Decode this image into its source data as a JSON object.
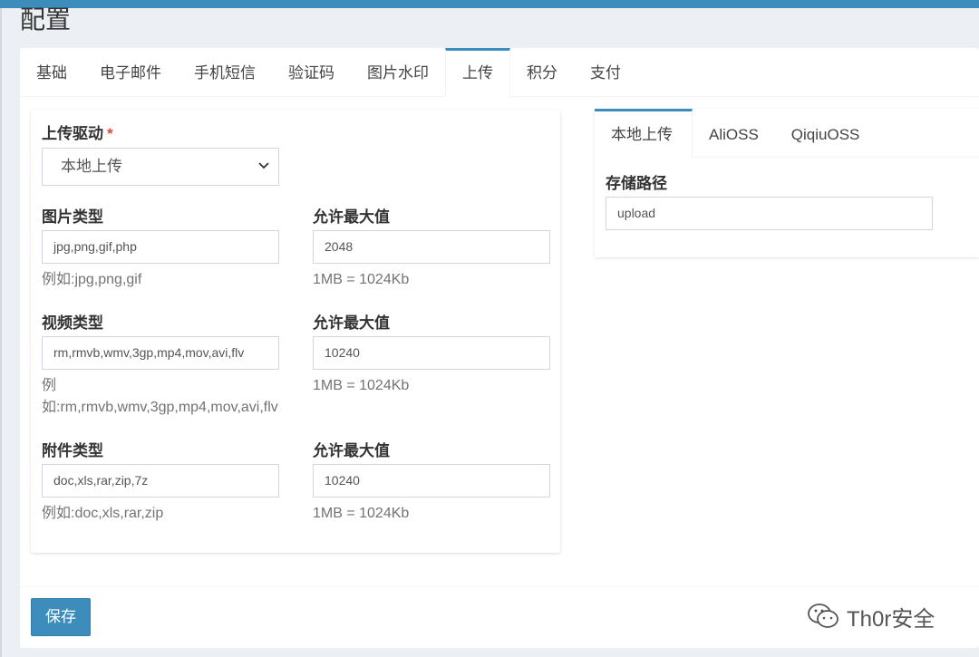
{
  "page": {
    "title": "配置"
  },
  "tabs": [
    {
      "label": "基础"
    },
    {
      "label": "电子邮件"
    },
    {
      "label": "手机短信"
    },
    {
      "label": "验证码"
    },
    {
      "label": "图片水印"
    },
    {
      "label": "上传"
    },
    {
      "label": "积分"
    },
    {
      "label": "支付"
    }
  ],
  "active_tab": "上传",
  "upload": {
    "driver_label": "上传驱动",
    "required_mark": "*",
    "driver_value": "本地上传",
    "image_type_label": "图片类型",
    "image_type_value": "jpg,png,gif,php",
    "image_type_help": "例如:jpg,png,gif",
    "image_max_label": "允许最大值",
    "image_max_value": "2048",
    "image_max_help": "1MB = 1024Kb",
    "video_type_label": "视频类型",
    "video_type_value": "rm,rmvb,wmv,3gp,mp4,mov,avi,flv",
    "video_type_help_line1": "例",
    "video_type_help_line2": "如:rm,rmvb,wmv,3gp,mp4,mov,avi,flv",
    "video_max_label": "允许最大值",
    "video_max_value": "10240",
    "video_max_help": "1MB = 1024Kb",
    "attach_type_label": "附件类型",
    "attach_type_value": "doc,xls,rar,zip,7z",
    "attach_type_help": "例如:doc,xls,rar,zip",
    "attach_max_label": "允许最大值",
    "attach_max_value": "10240",
    "attach_max_help": "1MB = 1024Kb"
  },
  "storage": {
    "tabs": [
      {
        "label": "本地上传"
      },
      {
        "label": "AliOSS"
      },
      {
        "label": "QiqiuOSS"
      }
    ],
    "path_label": "存储路径",
    "path_value": "upload"
  },
  "footer": {
    "save_label": "保存"
  },
  "watermark": {
    "text": "Th0r安全"
  },
  "colors": {
    "accent": "#3c8dbc",
    "required": "#dd4b39"
  }
}
